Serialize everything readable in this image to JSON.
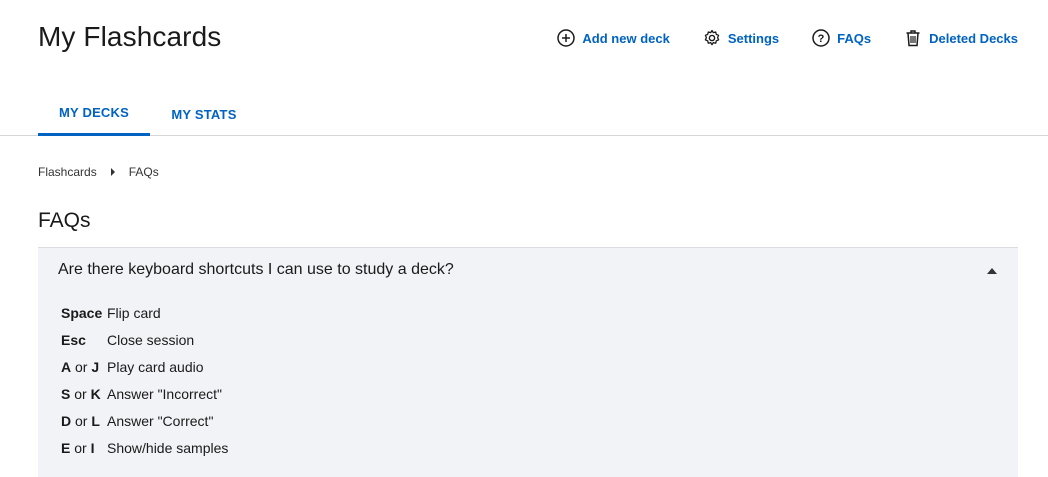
{
  "header": {
    "title": "My Flashcards",
    "actions": [
      {
        "label": "Add new deck",
        "icon": "plus-circle-icon"
      },
      {
        "label": "Settings",
        "icon": "gear-icon"
      },
      {
        "label": "FAQs",
        "icon": "question-circle-icon"
      },
      {
        "label": "Deleted Decks",
        "icon": "trash-icon"
      }
    ]
  },
  "tabs": [
    {
      "label": "MY DECKS",
      "active": true
    },
    {
      "label": "MY STATS",
      "active": false
    }
  ],
  "breadcrumb": [
    "Flashcards",
    "FAQs"
  ],
  "page_title": "FAQs",
  "faq": {
    "question": "Are there keyboard shortcuts I can use to study a deck?",
    "expanded": true,
    "shortcuts": [
      {
        "key1": "Space",
        "or": "",
        "key2": "",
        "desc": "Flip card"
      },
      {
        "key1": "Esc",
        "or": "",
        "key2": "",
        "desc": "Close session"
      },
      {
        "key1": "A",
        "or": " or ",
        "key2": "J",
        "desc": "Play card audio"
      },
      {
        "key1": "S",
        "or": " or ",
        "key2": "K",
        "desc": "Answer \"Incorrect\""
      },
      {
        "key1": "D",
        "or": " or ",
        "key2": "L",
        "desc": "Answer \"Correct\""
      },
      {
        "key1": "E",
        "or": " or ",
        "key2": "I",
        "desc": "Show/hide samples"
      }
    ]
  },
  "colors": {
    "accent": "#0063c2",
    "panel_bg": "#f2f3f7",
    "divider": "#d6d6d6"
  }
}
